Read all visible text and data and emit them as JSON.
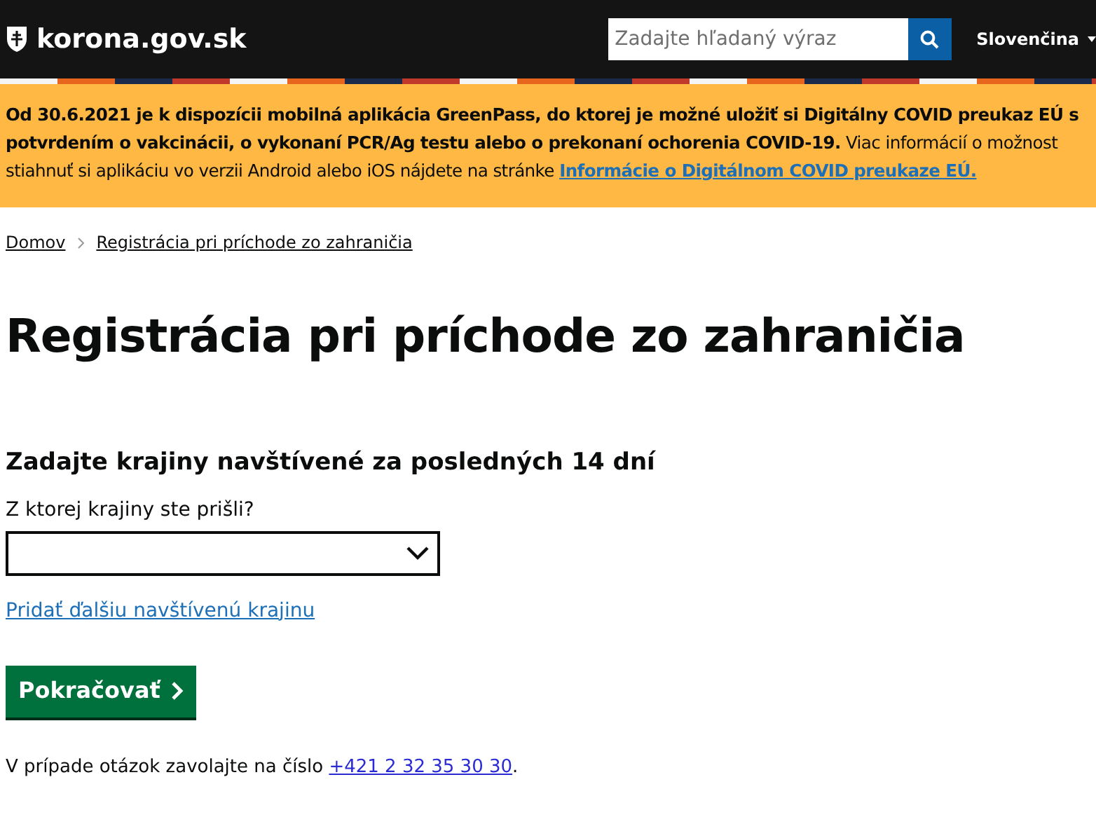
{
  "header": {
    "site_name": "korona.gov.sk",
    "search": {
      "placeholder": "Zadajte hľadaný výraz"
    },
    "language": "Slovenčina"
  },
  "banner": {
    "lines": [
      {
        "text": "**Od 30.6.2021 je k dispozícii mobilná aplikácia GreenPass, do ktorej je možné uložiť si Digitálny COVID preukaz EÚ s**"
      },
      {
        "text": "**potvrdením o vakcinácii, o vykonaní PCR/Ag testu alebo o prekonaní ochorenia COVID-19.** Viac informácií o možnost"
      },
      {
        "text": "stiahnuť si aplikáciu vo verzii Android alebo iOS nájdete na stránke ",
        "link": "Informácie o Digitálnom COVID preukaze EÚ."
      }
    ]
  },
  "breadcrumb": [
    "Domov",
    "Registrácia pri príchode zo zahraničia"
  ],
  "title": "Registrácia pri príchode zo zahraničia",
  "form": {
    "section_title": "Zadajte krajiny navštívené za posledných 14 dní",
    "field_label": "Z ktorej krajiny ste prišli?",
    "add_link": "Pridať ďalšiu navštívenú krajinu",
    "submit": "Pokračovať"
  },
  "footer_note": {
    "text": "V prípade otázok zavolajte na číslo ",
    "phone": "+421 2 32 35 30 30",
    "end": "."
  }
}
